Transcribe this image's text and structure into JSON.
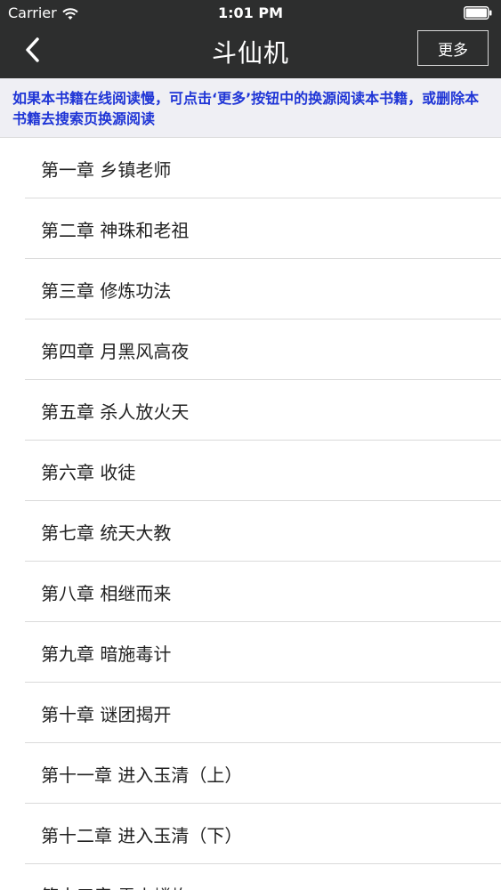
{
  "status_bar": {
    "carrier": "Carrier",
    "time": "1:01 PM",
    "wifi_icon": "wifi-icon",
    "battery_icon": "battery-icon"
  },
  "nav": {
    "title": "斗仙机",
    "back_icon": "chevron-left-icon",
    "more_label": "更多"
  },
  "notice": {
    "text": "如果本书籍在线阅读慢，可点击‘更多’按钮中的换源阅读本书籍，或删除本书籍去搜索页换源阅读",
    "color": "#1f35d6"
  },
  "chapters": [
    "第一章 乡镇老师",
    "第二章 神珠和老祖",
    "第三章 修炼功法",
    "第四章 月黑风高夜",
    "第五章 杀人放火天",
    "第六章 收徒",
    "第七章 统天大教",
    "第八章 相继而来",
    "第九章 暗施毒计",
    "第十章 谜团揭开",
    "第十一章 进入玉清（上）",
    "第十二章 进入玉清（下）",
    "第十三章 雷山嶙峋"
  ]
}
